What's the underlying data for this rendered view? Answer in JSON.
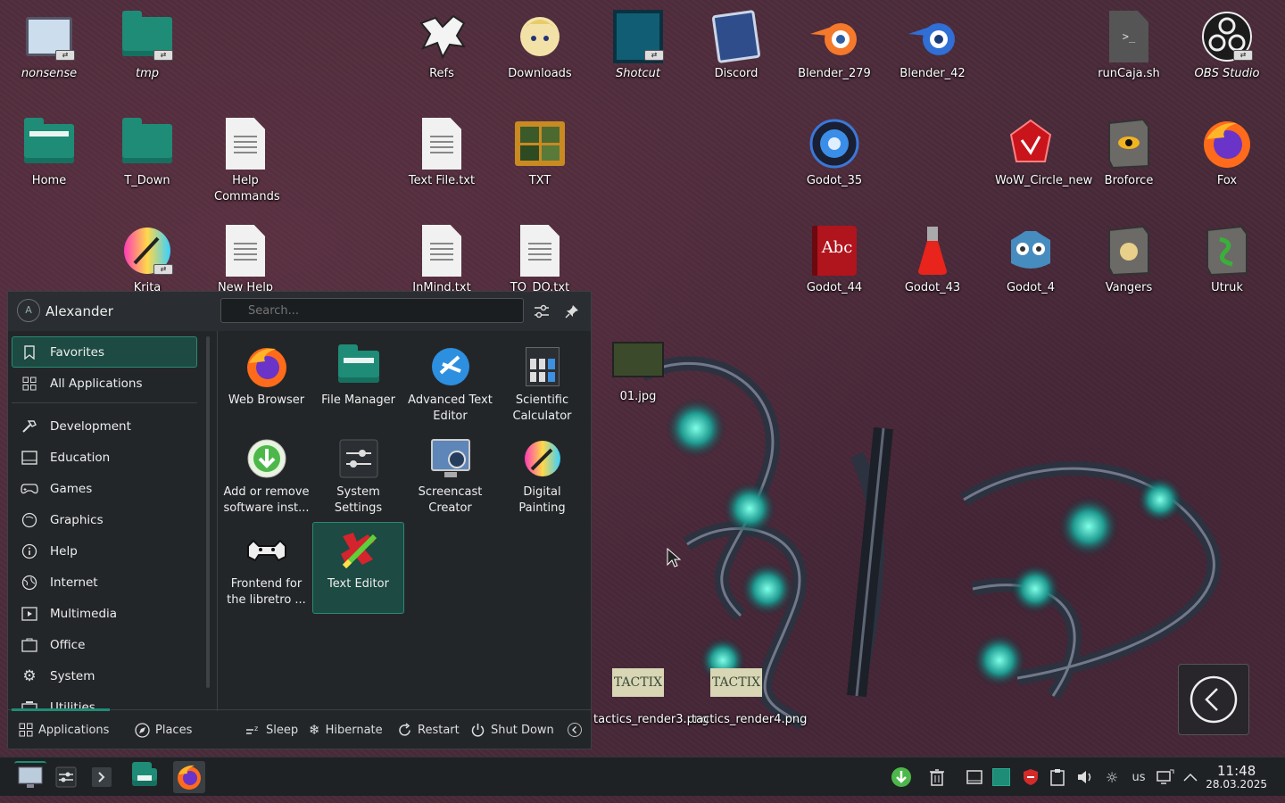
{
  "desktop": {
    "icons": [
      {
        "label": "nonsense",
        "italic": true,
        "icon": "monitor-icon"
      },
      {
        "label": "tmp",
        "italic": true,
        "icon": "folder-icon"
      },
      {
        "label": "Refs",
        "icon": "refs-icon"
      },
      {
        "label": "Downloads",
        "icon": "downloads-icon"
      },
      {
        "label": "Shotcut",
        "italic": true,
        "icon": "shotcut-icon"
      },
      {
        "label": "Discord",
        "icon": "discord-icon"
      },
      {
        "label": "Blender_279",
        "icon": "blender-icon"
      },
      {
        "label": "Blender_42",
        "icon": "blender-icon"
      },
      {
        "label": "runCaja.sh",
        "icon": "script-icon"
      },
      {
        "label": "OBS Studio",
        "italic": true,
        "icon": "obs-icon"
      },
      {
        "label": "Home",
        "icon": "folder-icon"
      },
      {
        "label": "T_Down",
        "icon": "folder-icon"
      },
      {
        "label": "Help Commands",
        "icon": "document-icon"
      },
      {
        "label": "Text File.txt",
        "icon": "document-icon"
      },
      {
        "label": "TXT",
        "icon": "folder-images-icon"
      },
      {
        "label": "Godot_35",
        "icon": "godot-icon"
      },
      {
        "label": "WoW_Circle_new",
        "icon": "wow-icon"
      },
      {
        "label": "Broforce",
        "icon": "broforce-icon"
      },
      {
        "label": "Fox",
        "icon": "firefox-icon"
      },
      {
        "label": "Krita",
        "icon": "krita-icon"
      },
      {
        "label": "New Help",
        "icon": "document-icon"
      },
      {
        "label": "InMind.txt",
        "icon": "document-icon"
      },
      {
        "label": "TO_DO.txt",
        "icon": "document-icon"
      },
      {
        "label": "Godot_44",
        "icon": "book-icon"
      },
      {
        "label": "Godot_43",
        "icon": "flask-icon"
      },
      {
        "label": "Godot_4",
        "icon": "godot-icon"
      },
      {
        "label": "Vangers",
        "icon": "vangers-icon"
      },
      {
        "label": "Utruk",
        "icon": "utruk-icon"
      },
      {
        "label": "01.jpg",
        "icon": "image-icon"
      },
      {
        "label": "tactics_render3.png",
        "icon": "image-icon",
        "thumb_text": "TACTIX"
      },
      {
        "label": "tactics_render4.png",
        "icon": "image-icon",
        "thumb_text": "TACTIX"
      }
    ]
  },
  "launcher": {
    "user": {
      "name": "Alexander",
      "initial": "A"
    },
    "search": {
      "placeholder": "Search..."
    },
    "categories": [
      {
        "label": "Favorites",
        "icon": "bookmark-icon",
        "selected": true
      },
      {
        "label": "All Applications",
        "icon": "grid-icon"
      },
      {
        "label": "Development",
        "icon": "hammer-icon"
      },
      {
        "label": "Education",
        "icon": "education-icon"
      },
      {
        "label": "Games",
        "icon": "gamepad-icon"
      },
      {
        "label": "Graphics",
        "icon": "graphics-icon"
      },
      {
        "label": "Help",
        "icon": "help-icon"
      },
      {
        "label": "Internet",
        "icon": "globe-icon"
      },
      {
        "label": "Multimedia",
        "icon": "multimedia-icon"
      },
      {
        "label": "Office",
        "icon": "office-icon"
      },
      {
        "label": "System",
        "icon": "gear-icon"
      },
      {
        "label": "Utilities",
        "icon": "utilities-icon"
      }
    ],
    "favorites": [
      {
        "label": "Web Browser",
        "icon": "firefox-icon"
      },
      {
        "label": "File Manager",
        "icon": "folder-icon"
      },
      {
        "label": "Advanced Text Editor",
        "icon": "kate-icon"
      },
      {
        "label": "Scientific Calculator",
        "icon": "calculator-icon"
      },
      {
        "label": "Add or remove software inst...",
        "icon": "software-install-icon"
      },
      {
        "label": "System Settings",
        "icon": "settings-icon"
      },
      {
        "label": "Screencast Creator",
        "icon": "screencast-icon"
      },
      {
        "label": "Digital Painting",
        "icon": "krita-icon"
      },
      {
        "label": "Frontend for the libretro ...",
        "icon": "retroarch-icon"
      },
      {
        "label": "Text Editor",
        "icon": "text-editor-icon",
        "selected": true
      }
    ],
    "footer": {
      "applications": "Applications",
      "places": "Places",
      "sleep": "Sleep",
      "hibernate": "Hibernate",
      "restart": "Restart",
      "shutdown": "Shut Down"
    }
  },
  "taskbar": {
    "keyboard_layout": "us",
    "time": "11:48",
    "date": "28.03.2025"
  },
  "colors": {
    "accent": "#1e8c76",
    "panel": "#232629",
    "wallpaper": "#4a2b3a"
  }
}
